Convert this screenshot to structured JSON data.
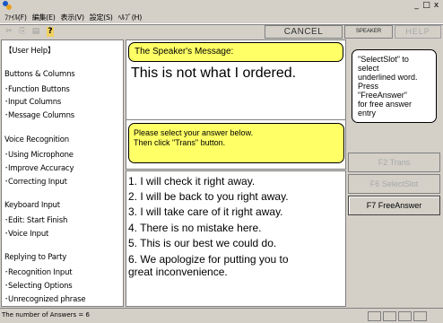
{
  "window": {
    "minimize": "_",
    "maximize": "□",
    "close": "x"
  },
  "menu": {
    "items": [
      "ﾌｧｲﾙ(F)",
      "編集(E)",
      "表示(V)",
      "設定(S)",
      "ﾍﾙﾌﾟ(H)"
    ]
  },
  "toolbar": {
    "cut_icon": "✂",
    "copy_icon": "⎘",
    "paste_icon": "▤",
    "help_icon": "?",
    "cancel": "CANCEL",
    "speaker_change": "SPEAKER CHANGE",
    "help": "HELP"
  },
  "left_panel": {
    "lines": [
      "【User Help】",
      "Buttons & Columns",
      "･Function Buttons",
      "･Input Columns",
      "･Message Columns",
      "Voice Recognition",
      "･Using Microphone",
      "･Improve Accuracy",
      "･Correcting Input",
      "Keyboard Input",
      "･Edit: Start Finish",
      "･Voice Input",
      "Replying to Party",
      "･Recognition Input",
      "･Selecting Options",
      "･Unrecognized phrase"
    ]
  },
  "speaker": {
    "label": "The Speaker's Message:",
    "message": "This is not what I ordered."
  },
  "instruction": {
    "line1": "Please select your answer below.",
    "line2": "Then click \"Trans\" button."
  },
  "answers": [
    "1. I will check it right away.",
    "2. I will be back to you right away.",
    "3. I will take care of it right away.",
    "4. There is no mistake here.",
    "5. This is our best we could do.",
    "6. We apologize for putting you to",
    "great inconvenience."
  ],
  "hint": {
    "lines": [
      "\"SelectSlot\" to",
      "select",
      "underlined word.",
      "Press",
      "\"FreeAnswer\"",
      "for free answer",
      "entry"
    ]
  },
  "buttons": {
    "f2": "F2 Trans",
    "f6": "F6 SelectSlot",
    "f7": "F7 FreeAnswer"
  },
  "status": {
    "text": "The number of Answers = 6"
  },
  "colors": {
    "yellow_box": "#ffff66",
    "window_bg": "#d4d0c8"
  }
}
